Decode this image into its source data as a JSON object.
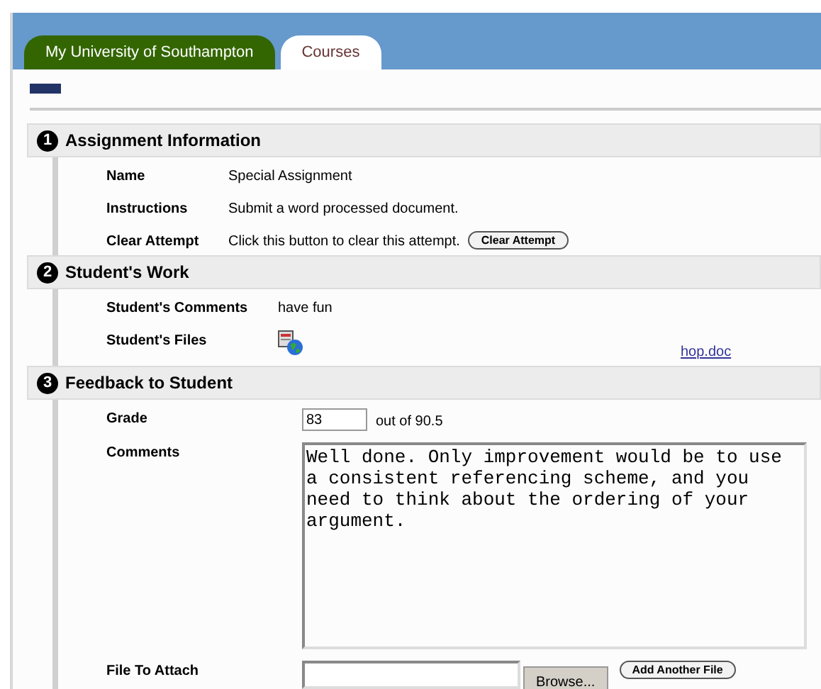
{
  "tabs": [
    {
      "label": "My University of Southampton",
      "selected": false
    },
    {
      "label": "Courses",
      "selected": true
    }
  ],
  "sections": [
    {
      "number": "1",
      "title": "Assignment Information",
      "rows": [
        {
          "kind": "text",
          "label": "Name",
          "value": "Special Assignment"
        },
        {
          "kind": "text",
          "label": "Instructions",
          "value": "Submit a word processed document."
        },
        {
          "kind": "action",
          "label": "Clear Attempt",
          "value": "Click this button to clear this attempt.",
          "button": "Clear Attempt"
        }
      ]
    },
    {
      "number": "2",
      "title": "Student's Work",
      "rows": [
        {
          "kind": "text",
          "label": "Student's Comments",
          "value": "have fun"
        },
        {
          "kind": "file",
          "label": "Student's Files",
          "link": "hop.doc"
        }
      ]
    },
    {
      "number": "3",
      "title": "Feedback to Student",
      "rows": [
        {
          "kind": "grade",
          "label": "Grade",
          "value": "83",
          "suffix": "out of 90.5"
        },
        {
          "kind": "comments",
          "label": "Comments",
          "value": "Well done. Only improvement would be to use a consistent referencing scheme, and you need to think about the ordering of your argument."
        },
        {
          "kind": "attach",
          "label": "File To Attach",
          "browse": "Browse...",
          "button": "Add Another File"
        }
      ]
    }
  ]
}
